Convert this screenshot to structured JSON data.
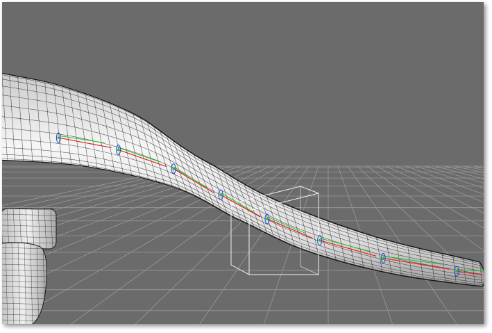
{
  "viewport": {
    "background_color": "#6b6b6b",
    "grid_color": "#9a9a9a",
    "mesh_fill_color": "#f0f0f0",
    "wire_color": "#1a1a1a",
    "joint_colors": {
      "x_axis": "#e02020",
      "y_axis": "#20c020",
      "z_axis": "#2040e0"
    },
    "selection_box_color": "#ffffff",
    "caption": ""
  },
  "scene": {
    "objects": [
      {
        "name": "tail-mesh",
        "icon": "mesh-icon"
      },
      {
        "name": "leg-mesh",
        "icon": "mesh-icon"
      },
      {
        "name": "bone-chain",
        "icon": "bone-icon",
        "joint_count": 8
      },
      {
        "name": "selection-bounding-box",
        "icon": "bounding-box-icon"
      },
      {
        "name": "ground-grid",
        "icon": "grid-icon"
      }
    ]
  }
}
